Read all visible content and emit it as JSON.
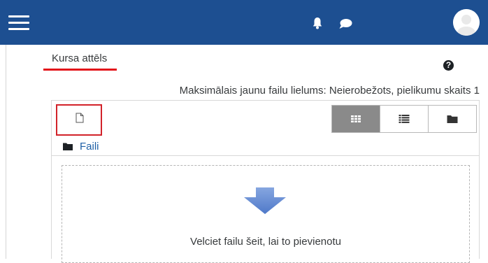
{
  "colors": {
    "navbar": "#1d4f91",
    "accent_red": "#e3141a",
    "link": "#1d5fa6",
    "active_view": "#8a8a8a"
  },
  "navbar": {
    "menu_icon": "hamburger-icon",
    "notification_icon": "bell-icon",
    "message_icon": "chat-bubble-icon",
    "user_icon": "avatar"
  },
  "field": {
    "label": "Kursa attēls",
    "help_icon": "question-circle-icon",
    "help_glyph": "?"
  },
  "filemanager": {
    "limits_text": "Maksimālais jaunu failu lielums: Neierobežots, pielikumu skaits 1",
    "add_file_icon": "file-icon",
    "views": [
      {
        "icon": "grid-icon",
        "active": true
      },
      {
        "icon": "list-icon",
        "active": false
      },
      {
        "icon": "folder-icon",
        "active": false
      }
    ],
    "path_label": "Faili",
    "drop_text": "Velciet failu šeit, lai to pievienotu",
    "drop_icon": "arrow-down-icon"
  }
}
